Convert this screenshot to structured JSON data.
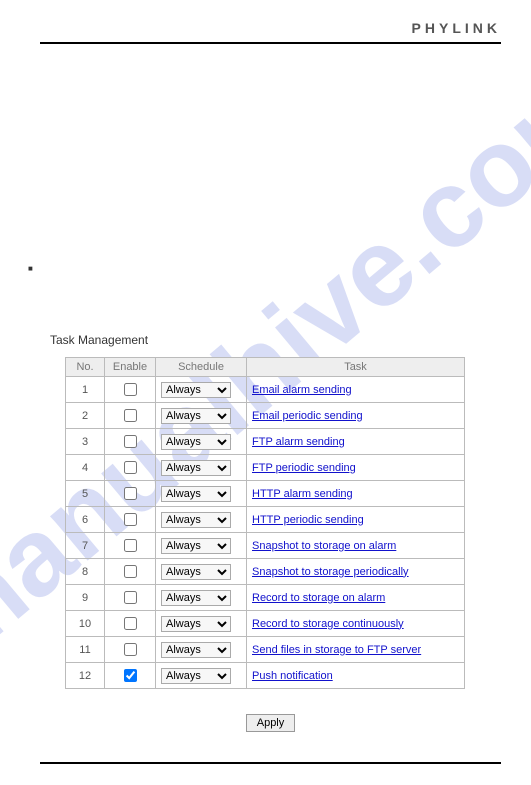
{
  "header": {
    "brand": "PHYLINK"
  },
  "section": {
    "title": "Task Management"
  },
  "table": {
    "headers": {
      "no": "No.",
      "enable": "Enable",
      "schedule": "Schedule",
      "task": "Task"
    },
    "schedule_option": "Always",
    "rows": [
      {
        "no": "1",
        "checked": false,
        "task": "Email alarm sending"
      },
      {
        "no": "2",
        "checked": false,
        "task": "Email periodic sending"
      },
      {
        "no": "3",
        "checked": false,
        "task": "FTP alarm sending"
      },
      {
        "no": "4",
        "checked": false,
        "task": "FTP periodic sending"
      },
      {
        "no": "5",
        "checked": false,
        "task": "HTTP alarm sending"
      },
      {
        "no": "6",
        "checked": false,
        "task": "HTTP periodic sending"
      },
      {
        "no": "7",
        "checked": false,
        "task": "Snapshot to storage on alarm"
      },
      {
        "no": "8",
        "checked": false,
        "task": "Snapshot to storage periodically"
      },
      {
        "no": "9",
        "checked": false,
        "task": "Record to storage on alarm"
      },
      {
        "no": "10",
        "checked": false,
        "task": "Record to storage continuously"
      },
      {
        "no": "11",
        "checked": false,
        "task": "Send files in storage to FTP server"
      },
      {
        "no": "12",
        "checked": true,
        "task": "Push notification"
      }
    ]
  },
  "buttons": {
    "apply": "Apply"
  },
  "watermark": "manualhive.com"
}
